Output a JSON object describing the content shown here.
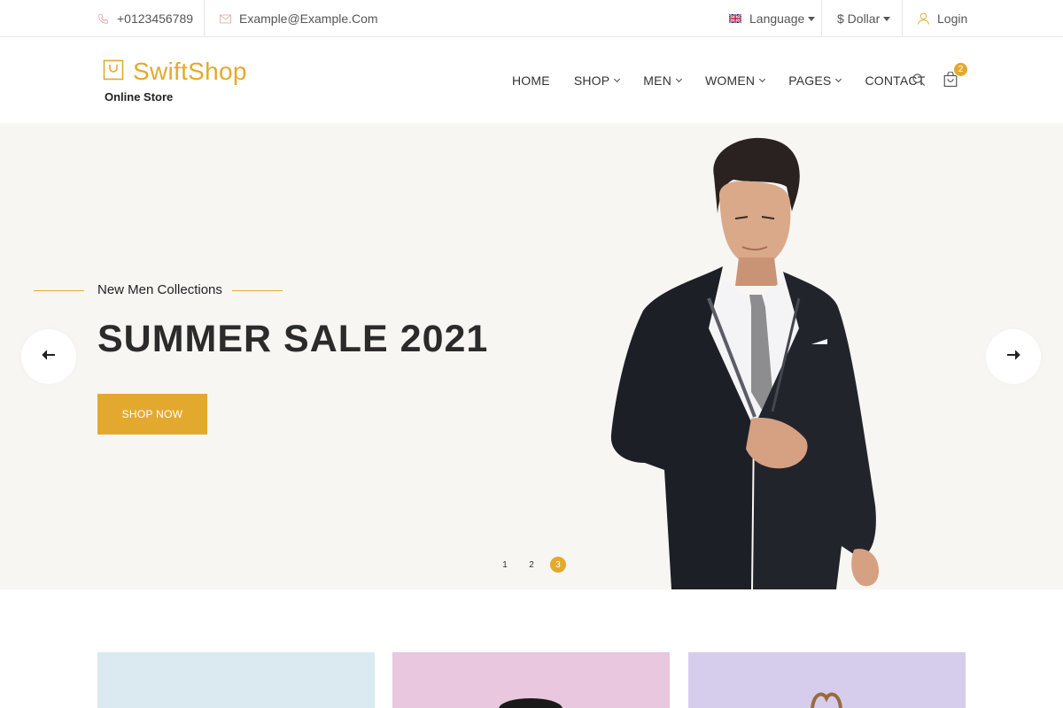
{
  "topbar": {
    "phone": "+0123456789",
    "email": "Example@Example.Com",
    "language": "Language",
    "currency": "$ Dollar",
    "login": "Login"
  },
  "header": {
    "brand": "SwiftShop",
    "tagline": "Online Store",
    "nav": [
      "HOME",
      "SHOP",
      "MEN",
      "WOMEN",
      "PAGES",
      "CONTACT"
    ],
    "cart_count": "2"
  },
  "hero": {
    "subtitle": "New Men Collections",
    "title": "SUMMER SALE 2021",
    "button": "SHOP NOW",
    "pagination": [
      "1",
      "2",
      "3"
    ],
    "active_page": "3"
  },
  "colors": {
    "accent": "#e3a92f",
    "hero_bg": "#f7f6f3",
    "card_blue": "#dbe9f0",
    "card_pink": "#e8c7df",
    "card_purple": "#d6cdec"
  },
  "icons": [
    "phone-icon",
    "mail-icon",
    "uk-flag-icon",
    "user-icon",
    "shopping-bag-logo-icon",
    "search-icon",
    "cart-icon",
    "arrow-left-icon",
    "arrow-right-icon"
  ]
}
